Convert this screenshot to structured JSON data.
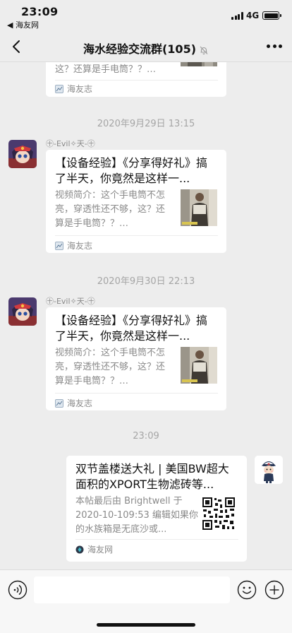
{
  "status_bar": {
    "time": "23:09",
    "back_app": "◀ 海友网",
    "network": "4G",
    "battery_level": 1.0
  },
  "nav": {
    "title": "海水经验交流群(105)",
    "muted": true
  },
  "messages": [
    {
      "type": "link-card",
      "title": "",
      "desc": "这？还算是手电筒？？…",
      "source": "海友志"
    },
    {
      "type": "timestamp",
      "text": "2020年9月29日 13:15"
    },
    {
      "type": "link-card",
      "sender": "㊉-Evil✧天-㊉",
      "title": "【设备经验】《分享得好礼》搞了半天，你竟然是这样一...",
      "desc": "视频简介：这个手电筒不怎亮，穿透性还不够，这？还算是手电筒？？…",
      "source": "海友志"
    },
    {
      "type": "timestamp",
      "text": "2020年9月30日 22:13"
    },
    {
      "type": "link-card",
      "sender": "㊉-Evil✧天-㊉",
      "title": "【设备经验】《分享得好礼》搞了半天，你竟然是这样一...",
      "desc": "视频简介：这个手电筒不怎亮，穿透性还不够，这？还算是手电筒？？…",
      "source": "海友志"
    },
    {
      "type": "timestamp",
      "text": "23:09"
    },
    {
      "type": "link-card",
      "outgoing": true,
      "title": "双节盖楼送大礼 | 美国BW超大面积的XPORT生物滤砖等...",
      "desc": "本帖最后由 Brightwell 于 2020-10-109:53 编辑如果你的水族箱是无底沙或...",
      "source": "海友网"
    }
  ],
  "colors": {
    "background": "#ededed",
    "card": "#ffffff",
    "meta_text": "#8a8a8a",
    "timestamp": "#a5a5a5"
  },
  "icons": [
    "back-chevron-icon",
    "mute-bell-icon",
    "more-dots-icon",
    "voice-icon",
    "emoji-icon",
    "plus-icon",
    "source-icon",
    "qr-code-icon"
  ]
}
